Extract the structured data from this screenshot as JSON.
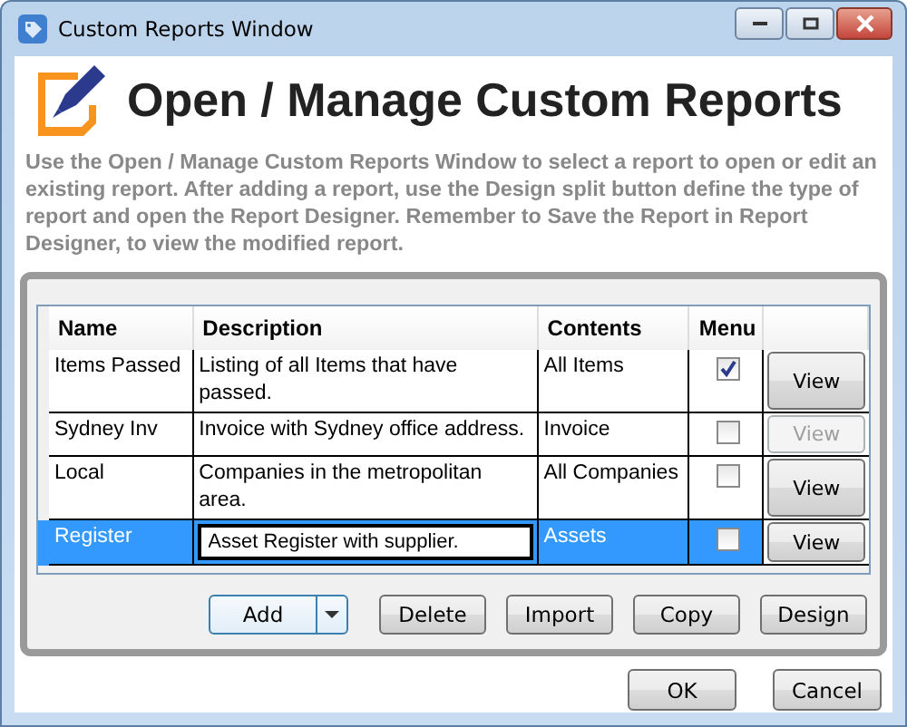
{
  "window": {
    "title": "Custom Reports Window"
  },
  "header": {
    "title": "Open / Manage Custom Reports",
    "description": "Use the Open / Manage Custom Reports Window to select a report to open or edit an existing report. After adding a report, use the Design split button define the type of report and open the Report Designer. Remember to Save the Report in Report Designer, to view the modified report."
  },
  "table": {
    "columns": [
      "Name",
      "Description",
      "Contents",
      "Menu"
    ],
    "rows": [
      {
        "name": "Items Passed",
        "description": "Listing of all Items that have passed.",
        "contents": "All Items",
        "menu": true,
        "view": "View",
        "view_disabled": false,
        "selected": false,
        "editing": false
      },
      {
        "name": "Sydney Inv",
        "description": "Invoice with Sydney office address.",
        "contents": "Invoice",
        "menu": false,
        "view": "View",
        "view_disabled": true,
        "selected": false,
        "editing": false
      },
      {
        "name": "Local",
        "description": "Companies in the metropolitan area.",
        "contents": "All Companies",
        "menu": false,
        "view": "View",
        "view_disabled": false,
        "selected": false,
        "editing": false
      },
      {
        "name": "Register",
        "description": "Asset Register with supplier.",
        "contents": "Assets",
        "menu": false,
        "view": "View",
        "view_disabled": false,
        "selected": true,
        "editing": true
      }
    ]
  },
  "actions": [
    {
      "label": "Add",
      "kind": "split"
    },
    {
      "label": "Delete",
      "kind": "plain"
    },
    {
      "label": "Import",
      "kind": "plain"
    },
    {
      "label": "Copy",
      "kind": "plain"
    },
    {
      "label": "Design",
      "kind": "plain"
    }
  ],
  "footer_buttons": [
    "OK",
    "Cancel"
  ]
}
